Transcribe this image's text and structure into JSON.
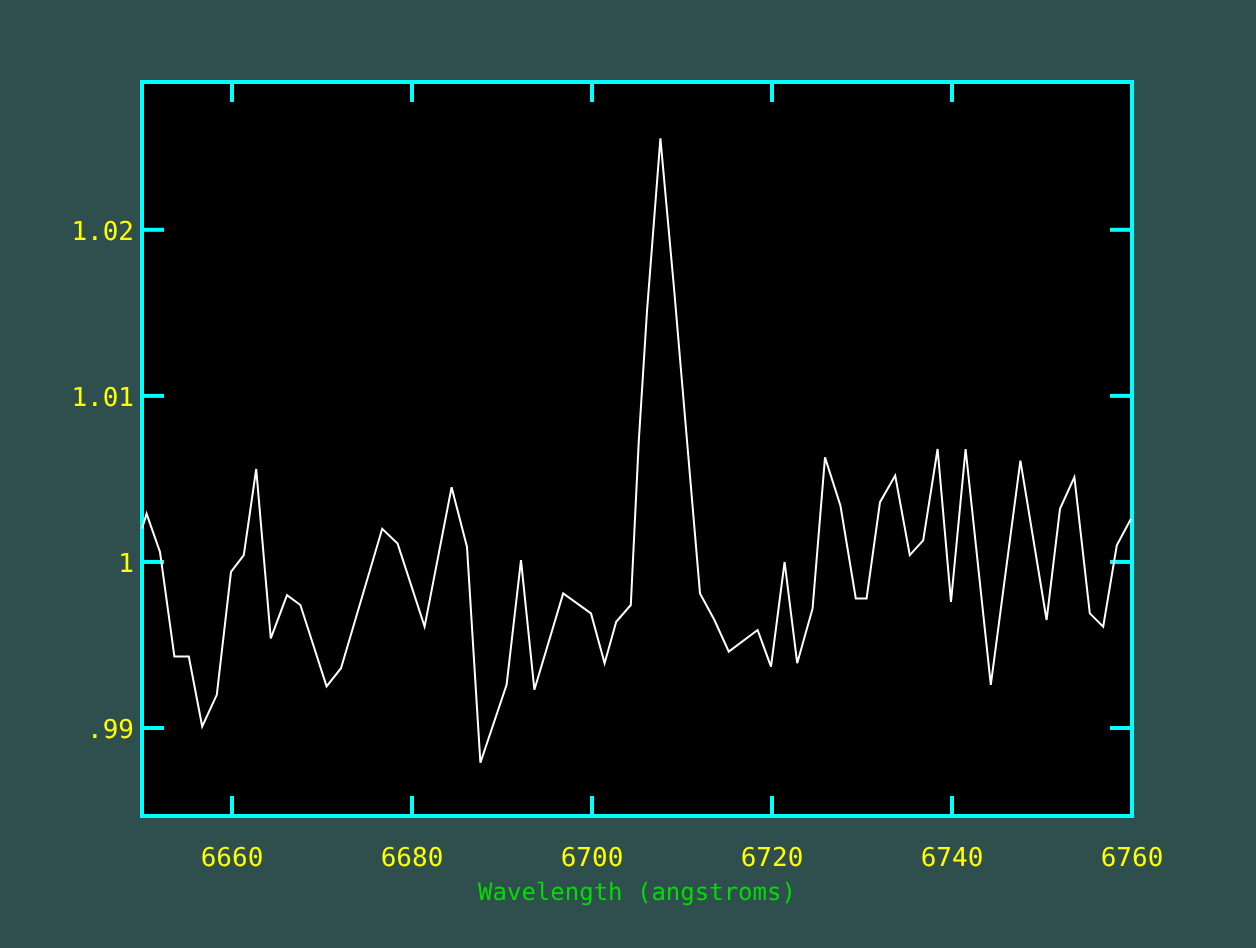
{
  "plot": {
    "chart_data": {
      "type": "line",
      "xlabel": "Wavelength (angstroms)",
      "xlim": [
        6650,
        6760
      ],
      "ylim": [
        0.9847,
        1.0289
      ],
      "xticks": [
        6660,
        6680,
        6700,
        6720,
        6740,
        6760
      ],
      "yticks": [
        {
          "value": 0.99,
          "label": ".99"
        },
        {
          "value": 1,
          "label": "1"
        },
        {
          "value": 1.01,
          "label": "1.01"
        },
        {
          "value": 1.02,
          "label": "1.02"
        }
      ],
      "x": [
        6650.0,
        6650.5,
        6652.0,
        6653.6,
        6655.2,
        6656.7,
        6658.3,
        6659.9,
        6661.3,
        6662.7,
        6664.3,
        6666.1,
        6667.6,
        6670.5,
        6672.1,
        6676.7,
        6678.4,
        6681.4,
        6684.4,
        6686.1,
        6687.6,
        6690.5,
        6692.1,
        6693.6,
        6696.8,
        6699.9,
        6701.4,
        6702.7,
        6704.3,
        6705.2,
        6706.1,
        6707.6,
        6709.1,
        6712.0,
        6713.6,
        6715.2,
        6718.4,
        6719.9,
        6721.4,
        6722.8,
        6724.5,
        6725.9,
        6727.6,
        6729.3,
        6730.5,
        6732.0,
        6733.7,
        6735.3,
        6736.8,
        6738.4,
        6739.9,
        6741.5,
        6744.3,
        6747.6,
        6750.5,
        6752.0,
        6753.6,
        6755.3,
        6756.8,
        6758.3,
        6759.9
      ],
      "series": [
        {
          "color": "#ffffff",
          "values": [
            1.002,
            1.0029,
            1.0006,
            0.9943,
            0.9943,
            0.9901,
            0.992,
            0.9994,
            1.0004,
            1.0056,
            0.9954,
            0.998,
            0.9974,
            0.9925,
            0.9936,
            1.002,
            1.0011,
            0.9961,
            1.0045,
            1.0009,
            0.9879,
            0.9926,
            1.0001,
            0.9923,
            0.9981,
            0.9969,
            0.9939,
            0.9964,
            0.9974,
            1.0073,
            1.0151,
            1.0255,
            1.0165,
            0.9981,
            0.9965,
            0.9946,
            0.9959,
            0.9937,
            1.0,
            0.9939,
            0.9972,
            1.0063,
            1.0034,
            0.9978,
            0.9978,
            1.0036,
            1.0052,
            1.0004,
            1.0013,
            1.0068,
            0.9976,
            1.0068,
            0.9926,
            1.0061,
            0.9965,
            1.0032,
            1.0051,
            0.9969,
            0.9961,
            1.001,
            1.0026
          ]
        }
      ]
    }
  }
}
